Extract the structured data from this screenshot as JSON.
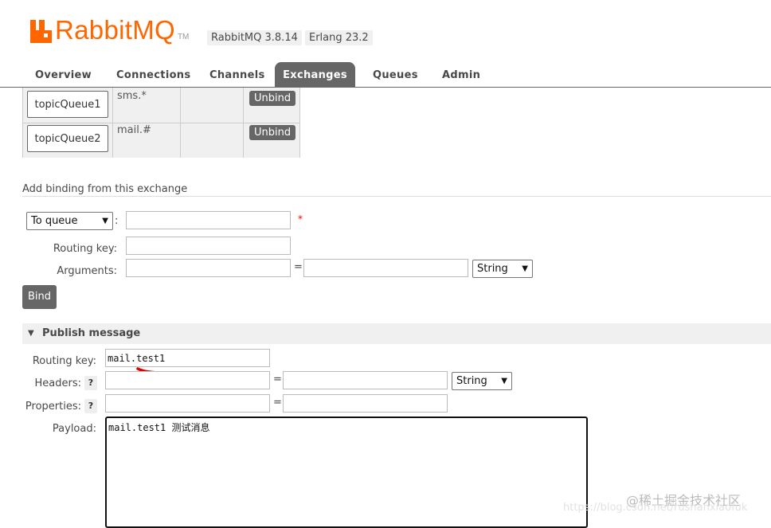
{
  "header": {
    "brand": "RabbitMQ",
    "tm": "TM",
    "version": "RabbitMQ 3.8.14",
    "erlang": "Erlang 23.2"
  },
  "tabs": [
    {
      "label": "Overview"
    },
    {
      "label": "Connections"
    },
    {
      "label": "Channels"
    },
    {
      "label": "Exchanges",
      "active": true
    },
    {
      "label": "Queues"
    },
    {
      "label": "Admin"
    }
  ],
  "bindings": [
    {
      "queue": "topicQueue1",
      "routing_key": "sms.*",
      "action": "Unbind"
    },
    {
      "queue": "topicQueue2",
      "routing_key": "mail.#",
      "action": "Unbind"
    }
  ],
  "add_binding": {
    "title": "Add binding from this exchange",
    "destination_type": "To queue",
    "colon": ":",
    "required_mark": "*",
    "routing_key_label": "Routing key:",
    "arguments_label": "Arguments:",
    "equals": "=",
    "arg_type": "String",
    "bind_label": "Bind"
  },
  "publish": {
    "title": "Publish message",
    "routing_key_label": "Routing key:",
    "routing_key_value": "mail.test1",
    "headers_label": "Headers:",
    "properties_label": "Properties:",
    "help_mark": "?",
    "equals": "=",
    "header_type": "String",
    "payload_label": "Payload:",
    "payload_value": "mail.test1  测试消息"
  },
  "watermark": {
    "brand": "@稀土掘金技术社区",
    "url": "https://blog.csdn.net/rushanxiaofuk"
  },
  "colors": {
    "brand_orange": "#ff6600",
    "tab_active": "#666666",
    "annotation_red": "#e00000"
  }
}
